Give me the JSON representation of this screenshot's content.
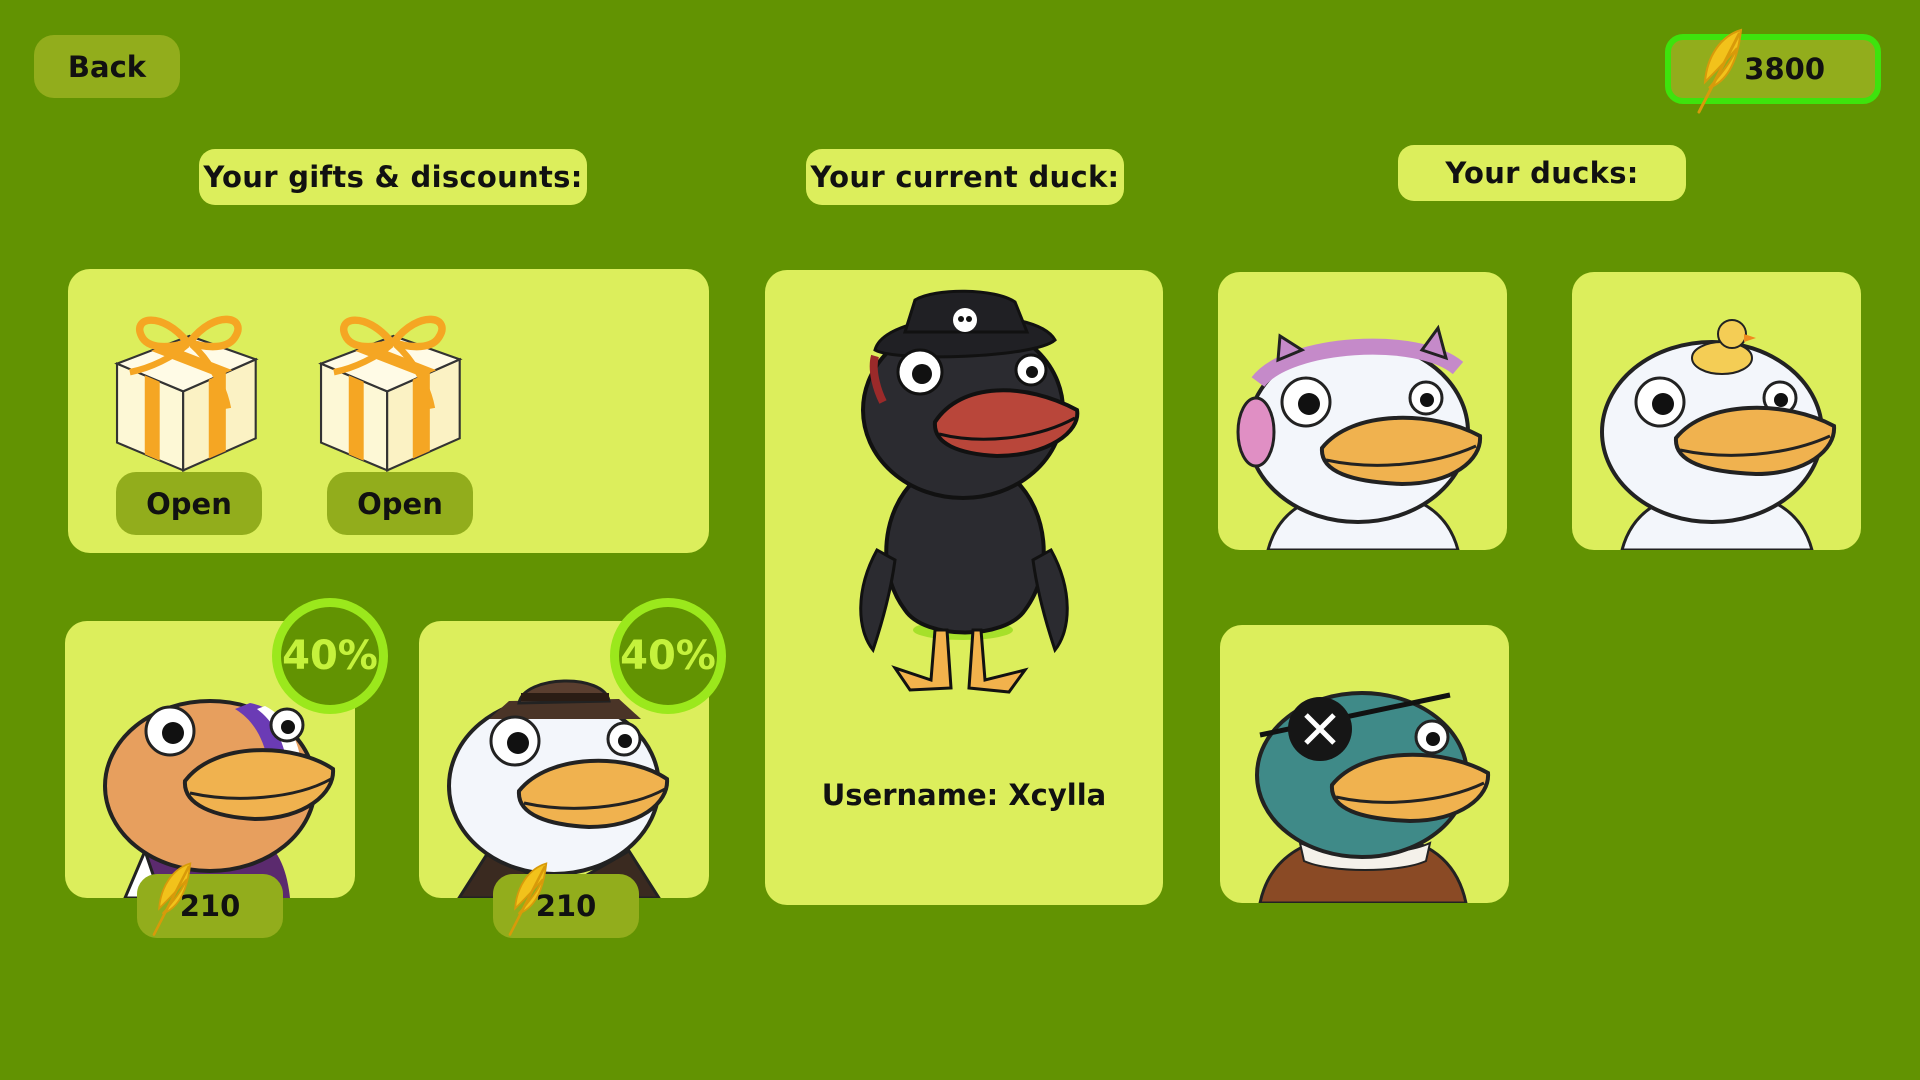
{
  "header": {
    "back_label": "Back",
    "feathers": "3800"
  },
  "sections": {
    "gifts_title": "Your gifts & discounts:",
    "current_title": "Your current duck:",
    "owned_title": "Your ducks:"
  },
  "gifts": [
    {
      "open_label": "Open"
    },
    {
      "open_label": "Open"
    }
  ],
  "discounts": [
    {
      "badge": "40%",
      "price": "210",
      "duck": "orange-duck-striped-cap-purple-sweater"
    },
    {
      "badge": "40%",
      "price": "210",
      "duck": "white-duck-fedora-bowtie"
    }
  ],
  "current_duck": {
    "username_label": "Username: Xcylla",
    "duck": "black-pirate-duck"
  },
  "owned_ducks": [
    {
      "duck": "white-duck-pink-cat-headphones"
    },
    {
      "duck": "white-duck-rubber-duck-hat"
    },
    {
      "duck": "teal-duck-eyepatch-ruff-collar"
    }
  ],
  "colors": {
    "background": "#629302",
    "panel": "#dcee5c",
    "button": "#92ad1c",
    "badge_ring": "#9be81c",
    "coin_border": "#3ee30d"
  }
}
